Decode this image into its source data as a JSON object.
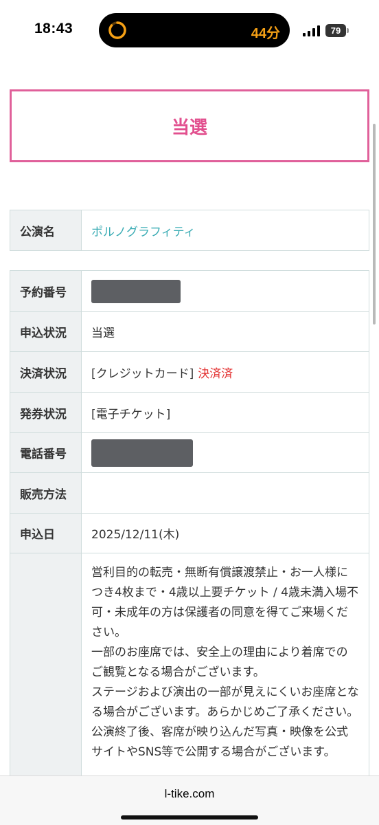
{
  "status_bar": {
    "time": "18:43",
    "timer_text": "44分",
    "battery": "79",
    "accent_color": "#f5a015"
  },
  "result": {
    "label": "当選",
    "color": "#e24f8e"
  },
  "performance": {
    "label": "公演名",
    "value": "ポルノグラフィティ"
  },
  "details": {
    "reservation_number": {
      "label": "予約番号"
    },
    "application_status": {
      "label": "申込状況",
      "value": "当選"
    },
    "payment_status": {
      "label": "決済状況",
      "method": "[クレジットカード]",
      "state": "決済済"
    },
    "ticketing_status": {
      "label": "発券状況",
      "value": "[電子チケット]"
    },
    "phone_number": {
      "label": "電話番号"
    },
    "sales_method": {
      "label": "販売方法",
      "value": ""
    },
    "application_date": {
      "label": "申込日",
      "value": "2025/12/11(木)"
    },
    "notes": [
      "営利目的の転売・無断有償譲渡禁止・お一人様につき4枚まで・4歳以上要チケット / 4歳未満入場不可・未成年の方は保護者の同意を得てご来場ください。",
      "一部のお座席では、安全上の理由により着席でのご観覧となる場合がございます。",
      "ステージおよび演出の一部が見えにくいお座席となる場合がございます。あらかじめご了承ください。",
      "公演終了後、客席が映り込んだ写真・映像を公式サイトやSNS等で公開する場合がございます。"
    ]
  },
  "browser": {
    "url": "l-tike.com"
  }
}
